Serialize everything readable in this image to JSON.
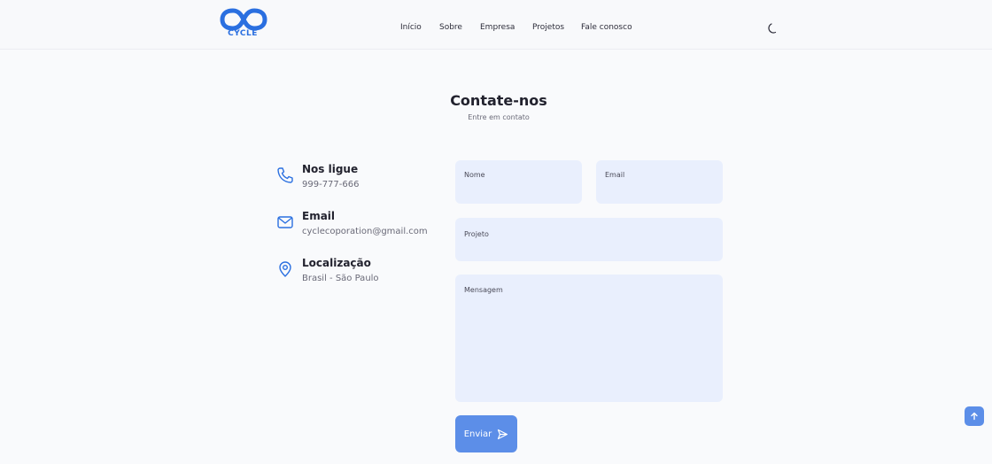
{
  "header": {
    "logo_text": "CYCLE",
    "nav": [
      {
        "label": "Início"
      },
      {
        "label": "Sobre"
      },
      {
        "label": "Empresa"
      },
      {
        "label": "Projetos"
      },
      {
        "label": "Fale conosco"
      }
    ],
    "theme_icon": "moon-icon"
  },
  "contact": {
    "title": "Contate-nos",
    "subtitle": "Entre em contato",
    "items": [
      {
        "title": "Nos ligue",
        "value": "999-777-666",
        "icon": "phone-icon"
      },
      {
        "title": "Email",
        "value": "cyclecoporation@gmail.com",
        "icon": "mail-icon"
      },
      {
        "title": "Localização",
        "value": "Brasil - São Paulo",
        "icon": "location-pin-icon"
      }
    ]
  },
  "form": {
    "name_label": "Nome",
    "email_label": "Email",
    "project_label": "Projeto",
    "message_label": "Mensagem",
    "submit_label": "Enviar",
    "submit_icon": "send-icon"
  },
  "scroll_top_icon": "arrow-up-icon",
  "colors": {
    "accent": "#5c8ee8",
    "brand": "#2a6fe0",
    "field_bg": "#e9effd",
    "page_bg": "#f9fafc"
  }
}
